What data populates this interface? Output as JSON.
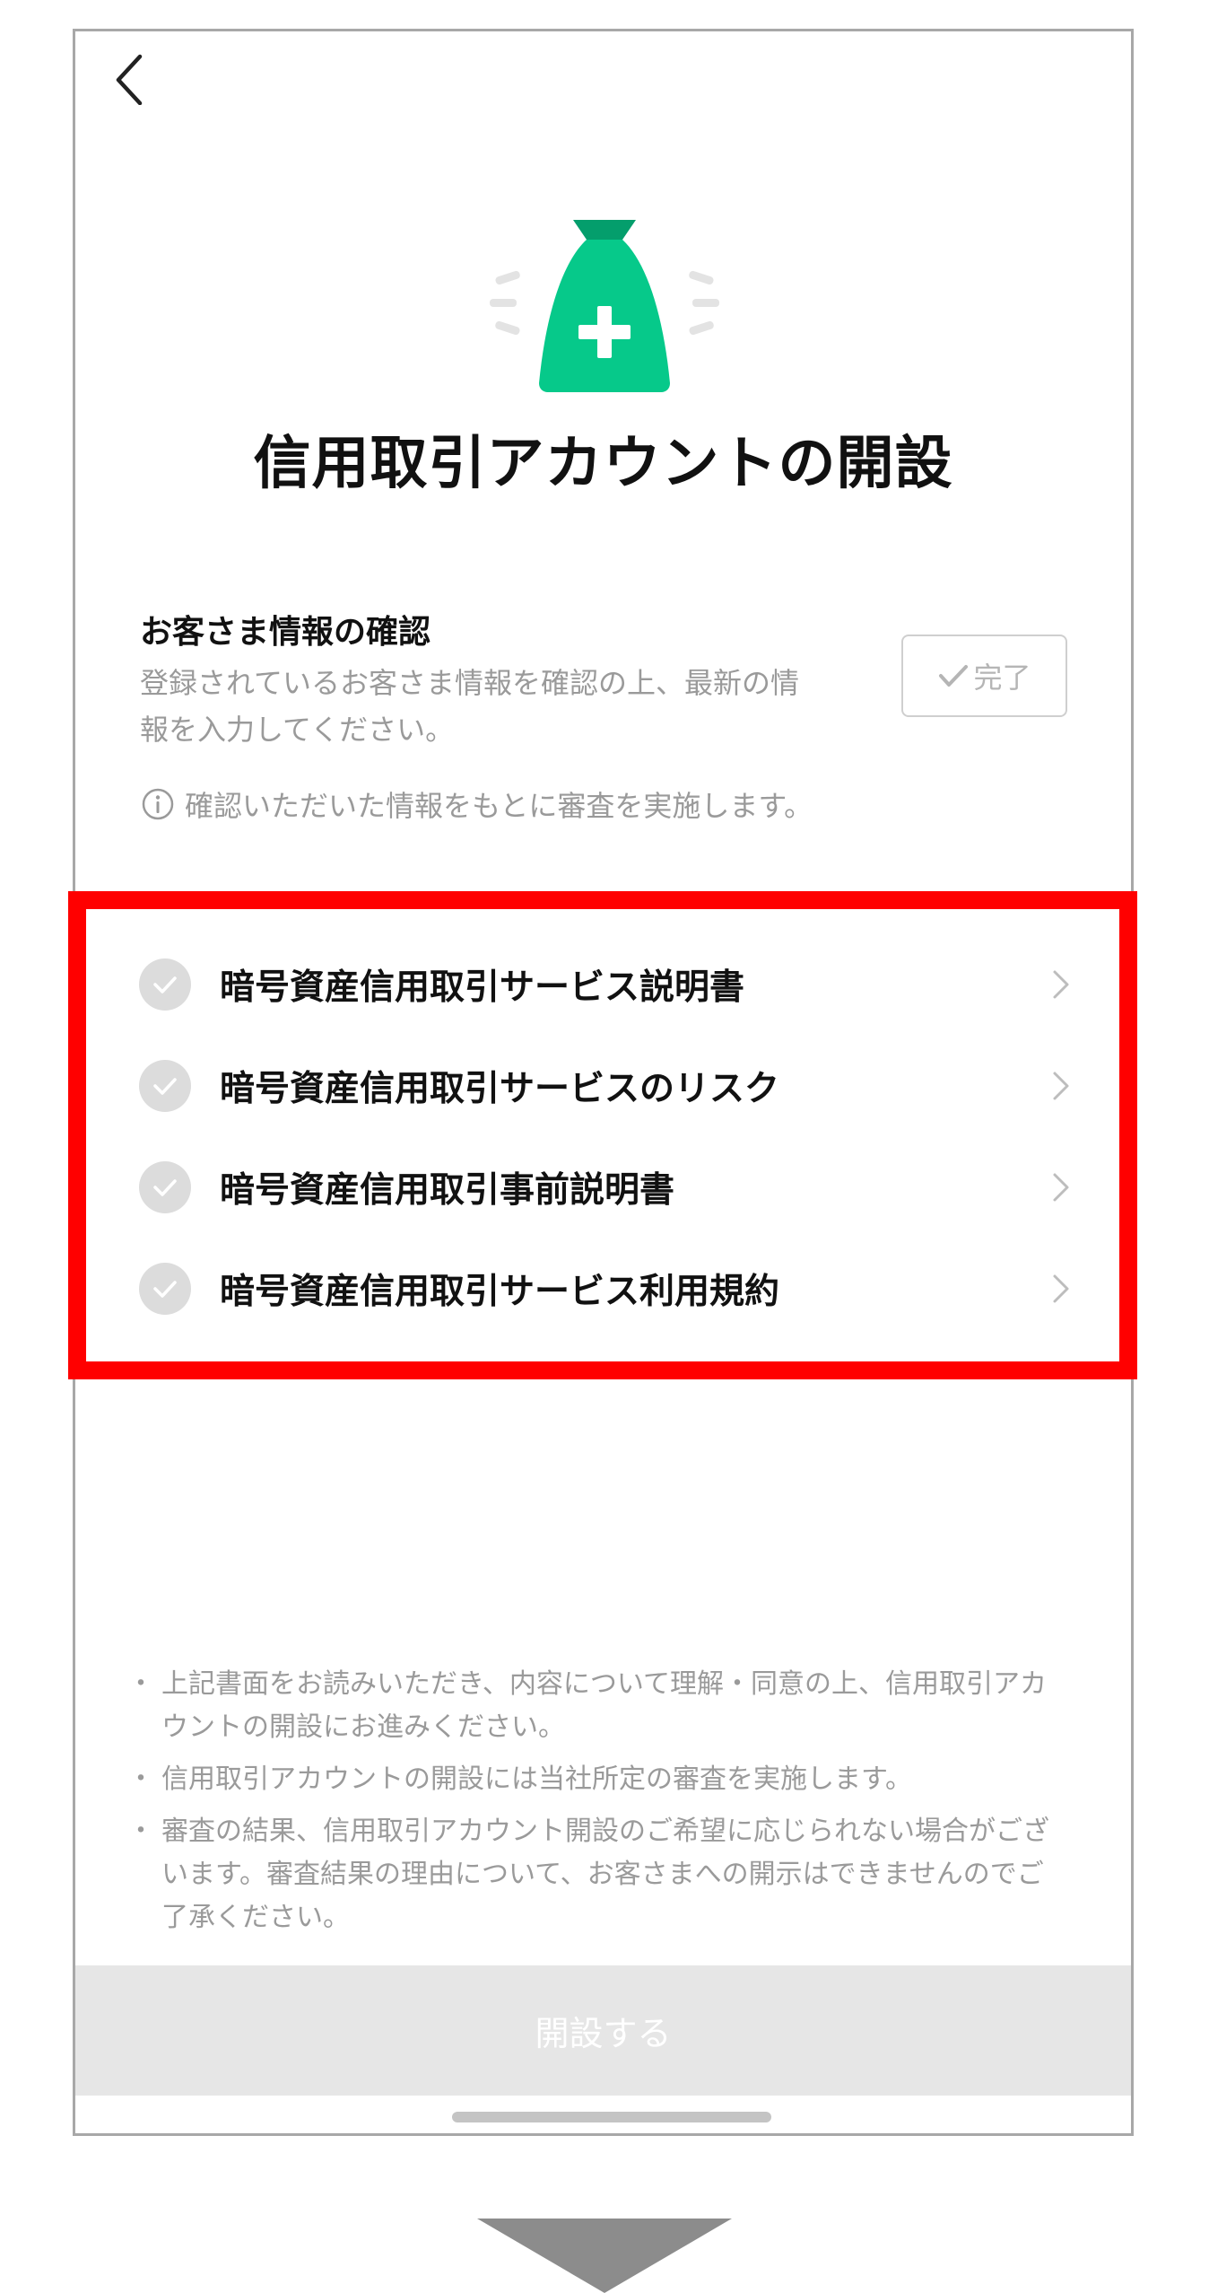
{
  "screen": {
    "title": "信用取引アカウントの開設"
  },
  "confirmation": {
    "heading": "お客さま情報の確認",
    "description": "登録されているお客さま情報を確認の上、最新の情報を入力してください。",
    "done_label": "完了",
    "note": "確認いただいた情報をもとに審査を実施します。"
  },
  "documents": [
    {
      "label": "暗号資産信用取引サービス説明書"
    },
    {
      "label": "暗号資産信用取引サービスのリスク"
    },
    {
      "label": "暗号資産信用取引事前説明書"
    },
    {
      "label": "暗号資産信用取引サービス利用規約"
    }
  ],
  "notes": [
    "上記書面をお読みいただき、内容について理解・同意の上、信用取引アカウントの開設にお進みください。",
    "信用取引アカウントの開設には当社所定の審査を実施します。",
    "審査の結果、信用取引アカウント開設のご希望に応じられない場合がございます。審査結果の理由について、お客さまへの開示はできませんのでご了承ください。"
  ],
  "primary_action": {
    "label": "開設する"
  },
  "icons": {
    "back": "chevron-left-icon",
    "hero": "money-bag-plus-icon",
    "check": "check-icon",
    "info": "info-icon",
    "chevron": "chevron-right-icon",
    "arrow": "down-triangle-icon"
  },
  "colors": {
    "brand_green": "#06C98A",
    "highlight_red": "#FF0000",
    "muted_text": "#9A9A9A",
    "disabled_button": "#E6E6E6"
  }
}
